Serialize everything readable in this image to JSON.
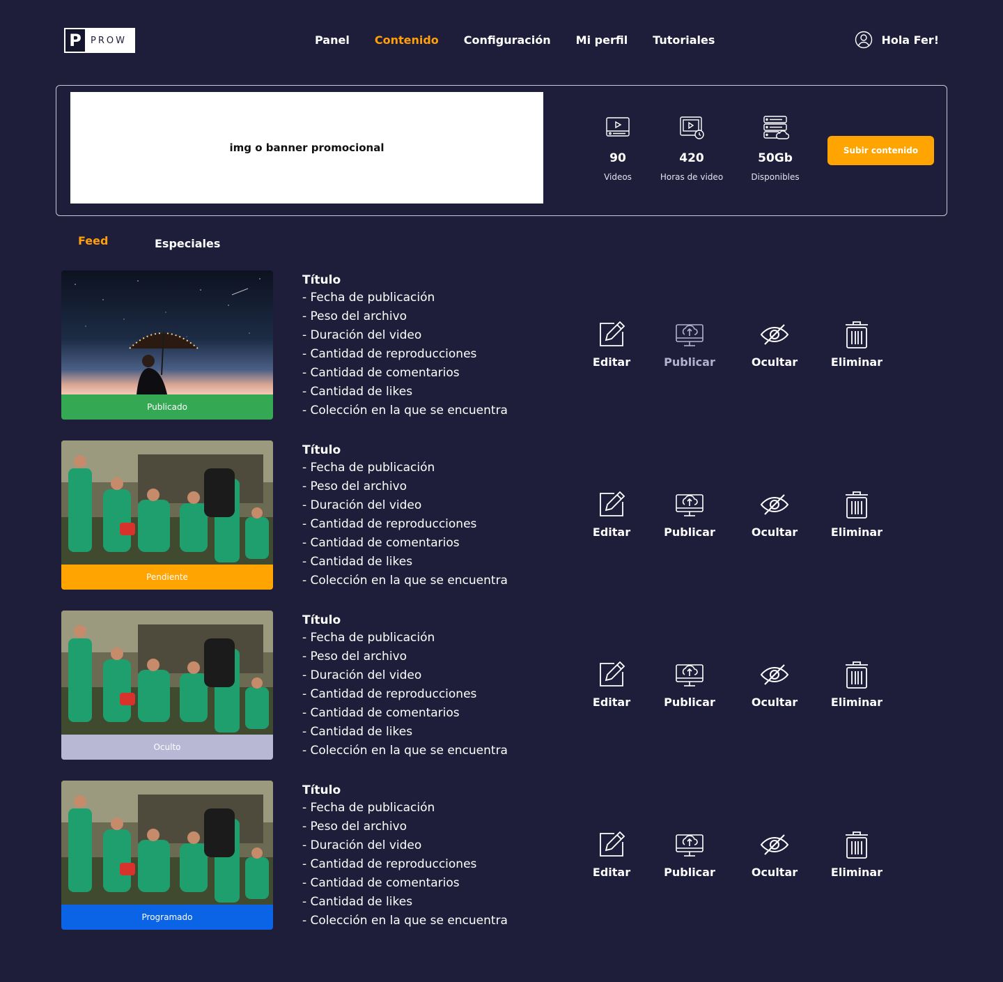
{
  "header": {
    "logo_text": "PROW",
    "nav": [
      {
        "label": "Panel",
        "active": false
      },
      {
        "label": "Contenido",
        "active": true
      },
      {
        "label": "Configuración",
        "active": false
      },
      {
        "label": "Mi perfil",
        "active": false
      },
      {
        "label": "Tutoriales",
        "active": false
      }
    ],
    "user_greeting": "Hola Fer!"
  },
  "summary": {
    "banner_text": "img o banner promocional",
    "stats": [
      {
        "icon": "video-player-icon",
        "value": "90",
        "label": "Videos"
      },
      {
        "icon": "video-clock-icon",
        "value": "420",
        "label": "Horas de video"
      },
      {
        "icon": "server-cloud-icon",
        "value": "50Gb",
        "label": "Disponibles"
      }
    ],
    "upload_button": "Subir contenido"
  },
  "tabs": [
    {
      "label": "Feed",
      "active": true
    },
    {
      "label": "Especiales",
      "active": false
    }
  ],
  "colors": {
    "background": "#1f1e3a",
    "accent": "#ff9f0a",
    "status_publicado": "#34a853",
    "status_pendiente": "#ffa400",
    "status_oculto": "#b8b7d4",
    "status_programado": "#0b63e6"
  },
  "videos": [
    {
      "status": "Publicado",
      "title": "Título",
      "details": [
        "- Fecha de publicación",
        "- Peso del archivo",
        "- Duración del video",
        "- Cantidad de reproducciones",
        "- Cantidad de comentarios",
        "- Cantidad de likes",
        "- Colección en la que se encuentra"
      ],
      "actions": [
        "Editar",
        "Publicar",
        "Ocultar",
        "Eliminar"
      ]
    },
    {
      "status": "Pendiente",
      "title": "Título",
      "details": [
        "- Fecha de publicación",
        "- Peso del archivo",
        "- Duración del video",
        "- Cantidad de reproducciones",
        "- Cantidad de comentarios",
        "- Cantidad de likes",
        "- Colección en la que se encuentra"
      ],
      "actions": [
        "Editar",
        "Publicar",
        "Ocultar",
        "Eliminar"
      ]
    },
    {
      "status": "Oculto",
      "title": "Título",
      "details": [
        "- Fecha de publicación",
        "- Peso del archivo",
        "- Duración del video",
        "- Cantidad de reproducciones",
        "- Cantidad de comentarios",
        "- Cantidad de likes",
        "- Colección en la que se encuentra"
      ],
      "actions": [
        "Editar",
        "Publicar",
        "Ocultar",
        "Eliminar"
      ]
    },
    {
      "status": "Programado",
      "title": "Título",
      "details": [
        "- Fecha de publicación",
        "- Peso del archivo",
        "- Duración del video",
        "- Cantidad de reproducciones",
        "- Cantidad de comentarios",
        "- Cantidad de likes",
        "- Colección en la que se encuentra"
      ],
      "actions": [
        "Editar",
        "Publicar",
        "Ocultar",
        "Eliminar"
      ]
    }
  ]
}
